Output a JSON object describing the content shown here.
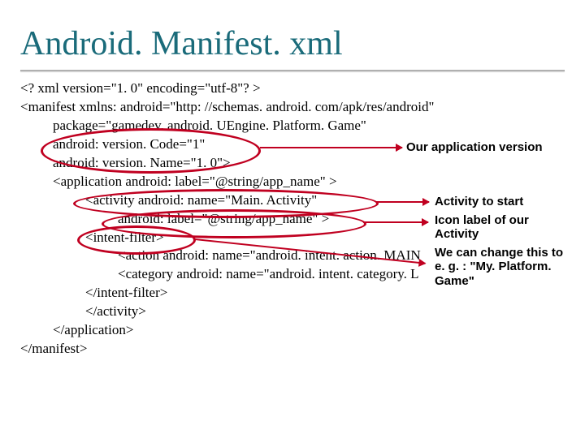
{
  "title": "Android. Manifest. xml",
  "code": {
    "l1": "<? xml version=\"1. 0\" encoding=\"utf-8\"? >",
    "l2": "<manifest xmlns: android=\"http: //schemas. android. com/apk/res/android\"",
    "l3": "package=\"gamedev. android. UEngine. Platform. Game\"",
    "l4": "android: version. Code=\"1\"",
    "l5": "android: version. Name=\"1. 0\">",
    "l6": "<application android: label=\"@string/app_name\" >",
    "l7": "<activity android: name=\"Main. Activity\"",
    "l8": "android: label=\"@string/app_name\" >",
    "l9": "<intent-filter>",
    "l10": "<action android: name=\"android. intent. action. MAIN",
    "l11": "<category android: name=\"android. intent. category. L",
    "l12": "</intent-filter>",
    "l13": "</activity>",
    "l14": "</application>",
    "l15": "</manifest>"
  },
  "annotations": {
    "a1": "Our application version",
    "a2": "Activity to start",
    "a3": "Icon label of our Activity",
    "a4": "We can change this to e. g. : \"My. Platform. Game\""
  }
}
